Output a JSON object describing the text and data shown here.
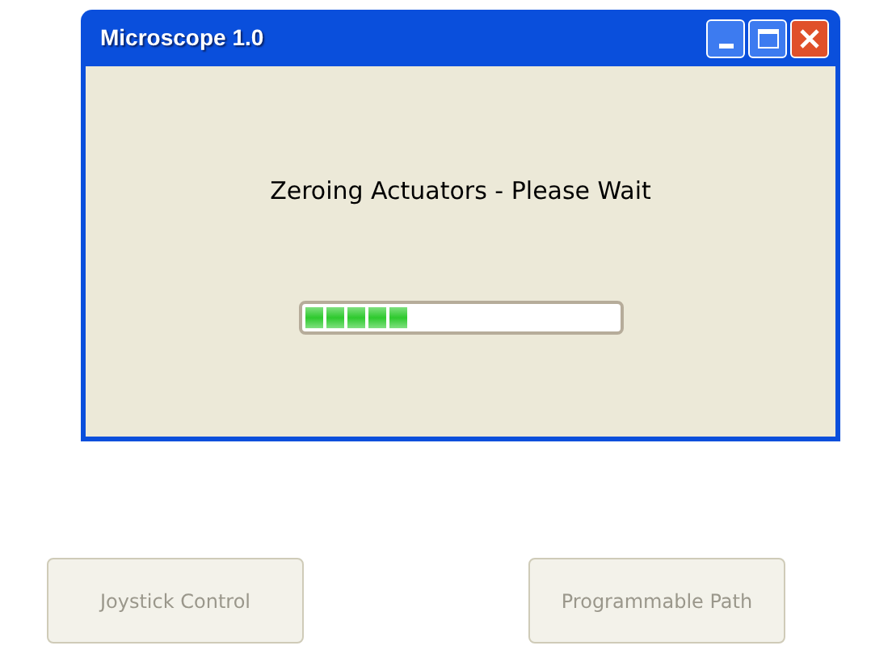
{
  "dialog": {
    "title": "Microscope 1.0",
    "message": "Zeroing Actuators - Please Wait",
    "progress": {
      "level": 0.33
    }
  },
  "buttons": [
    {
      "label": "Joystick Control",
      "disabled": true
    },
    {
      "label": "Programmable Path",
      "disabled": true
    }
  ]
}
